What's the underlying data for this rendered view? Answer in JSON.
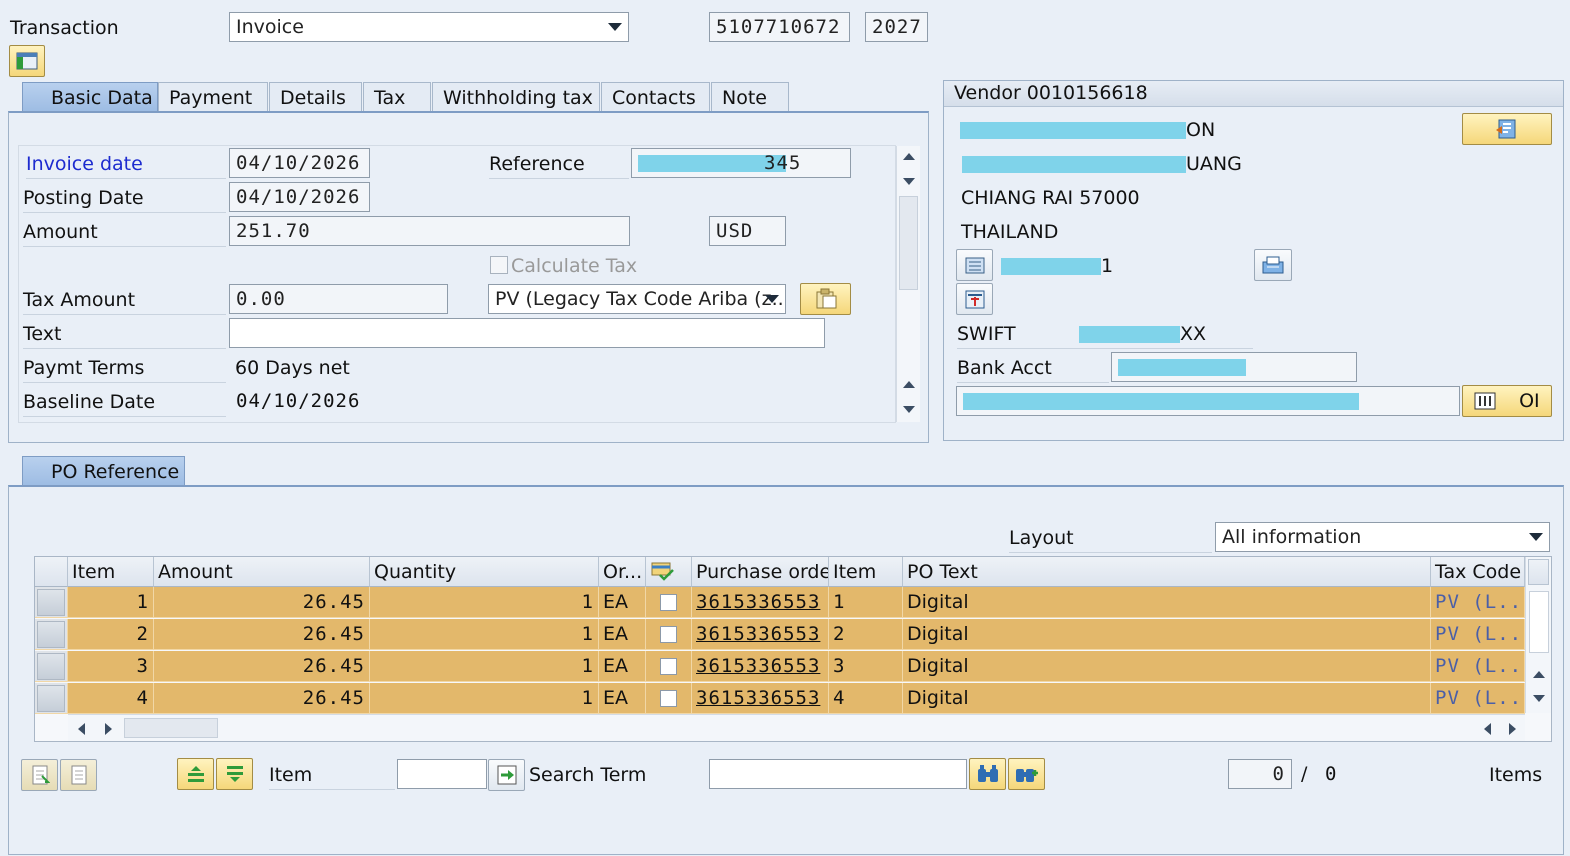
{
  "header": {
    "transaction_label": "Transaction",
    "transaction_value": "Invoice",
    "doc_number": "5107710672",
    "fiscal_year": "2027"
  },
  "tabs": [
    "Basic Data",
    "Payment",
    "Details",
    "Tax",
    "Withholding tax",
    "Contacts",
    "Note"
  ],
  "basic_data": {
    "invoice_date_label": "Invoice date",
    "invoice_date": "04/10/2026",
    "reference_label": "Reference",
    "reference_value": "345",
    "posting_date_label": "Posting Date",
    "posting_date": "04/10/2026",
    "amount_label": "Amount",
    "amount": "251.70",
    "currency": "USD",
    "calc_tax_label": "Calculate Tax",
    "tax_amount_label": "Tax Amount",
    "tax_amount": "0.00",
    "tax_code": "PV (Legacy Tax Code Ariba (z...",
    "text_label": "Text",
    "text_value": "",
    "paymt_terms_label": "Paymt Terms",
    "paymt_terms": "60 Days net",
    "baseline_date_label": "Baseline Date",
    "baseline_date": "04/10/2026"
  },
  "vendor": {
    "title": "Vendor 0010156618",
    "line1_suffix": "ON",
    "line2_suffix": "UANG",
    "city_line": "CHIANG RAI  57000",
    "country": "THAILAND",
    "phone_suffix": "1",
    "swift_label": "SWIFT",
    "swift_suffix": "XX",
    "bank_acct_label": "Bank Acct",
    "oi_label": "OI"
  },
  "po_reference": {
    "tab_label": "PO Reference",
    "layout_label": "Layout",
    "layout_value": "All information",
    "columns": [
      "Item",
      "Amount",
      "Quantity",
      "Or...",
      "Purchase order",
      "Item",
      "PO Text",
      "Tax Code"
    ],
    "rows": [
      {
        "item": "1",
        "amount": "26.45",
        "qty": "1",
        "unit": "EA",
        "po": "3615336553",
        "po_item": "1",
        "text": "Digital",
        "tax": "PV  (L..."
      },
      {
        "item": "2",
        "amount": "26.45",
        "qty": "1",
        "unit": "EA",
        "po": "3615336553",
        "po_item": "2",
        "text": "Digital",
        "tax": "PV  (L..."
      },
      {
        "item": "3",
        "amount": "26.45",
        "qty": "1",
        "unit": "EA",
        "po": "3615336553",
        "po_item": "3",
        "text": "Digital",
        "tax": "PV  (L..."
      },
      {
        "item": "4",
        "amount": "26.45",
        "qty": "1",
        "unit": "EA",
        "po": "3615336553",
        "po_item": "4",
        "text": "Digital",
        "tax": "PV  (L..."
      }
    ]
  },
  "footer": {
    "item_label": "Item",
    "search_term_label": "Search Term",
    "count_current": "0",
    "count_sep": "/",
    "count_total": "0",
    "items_label": "Items"
  },
  "colors": {
    "row_highlight": "#e3b86b",
    "button_yellow": "#f5d77a",
    "mask_cyan": "#7fd3ea",
    "link_blue": "#1d2bcf"
  }
}
